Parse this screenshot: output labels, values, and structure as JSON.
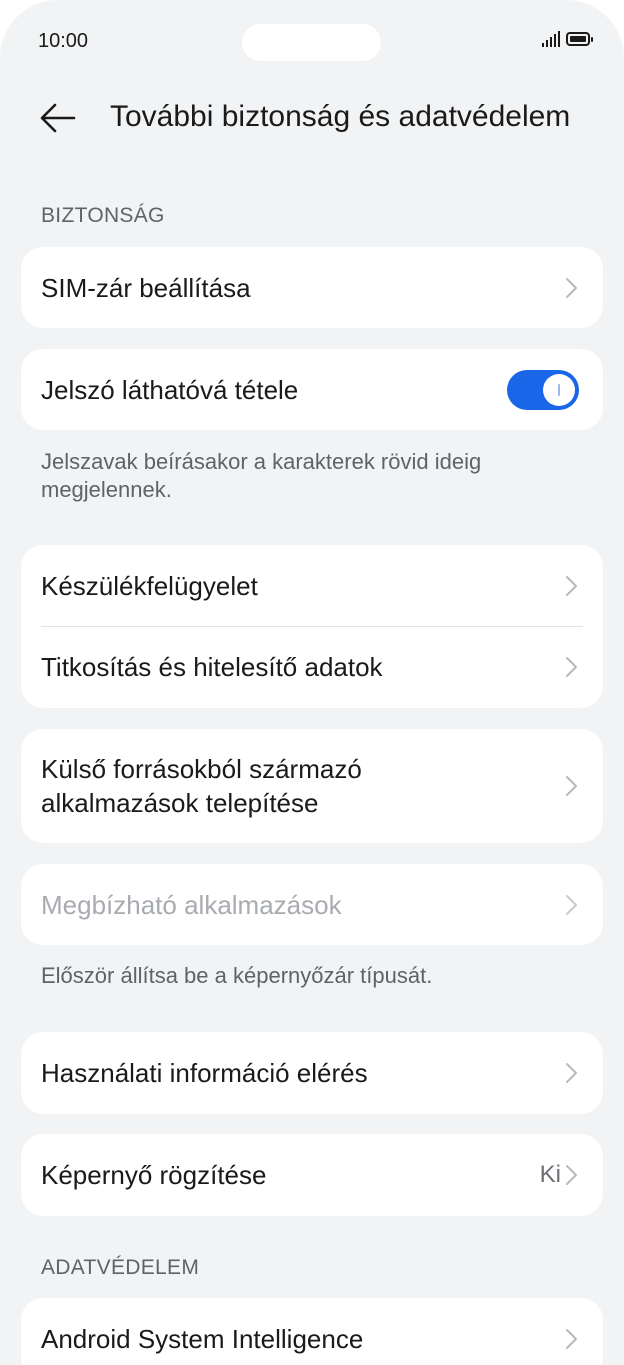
{
  "status_bar": {
    "time": "10:00"
  },
  "header": {
    "title": "További biztonság és adatvédelem"
  },
  "sections": {
    "security_label": "BIZTONSÁG",
    "privacy_label": "ADATVÉDELEM"
  },
  "items": {
    "sim_lock": {
      "label": "SIM-zár beállítása"
    },
    "show_password": {
      "label": "Jelszó láthatóvá tétele",
      "enabled": true
    },
    "show_password_note": "Jelszavak beírásakor a karakterek rövid ideig megjelennek.",
    "device_admin": {
      "label": "Készülékfelügyelet"
    },
    "encryption": {
      "label": "Titkosítás és hitelesítő adatok"
    },
    "external_sources": {
      "label": "Külső forrásokból származó alkalmazások telepítése"
    },
    "trusted_agents": {
      "label": "Megbízható alkalmazások",
      "disabled": true
    },
    "trusted_agents_note": "Először állítsa be a képernyőzár típusát.",
    "usage_access": {
      "label": "Használati információ elérés"
    },
    "screen_pinning": {
      "label": "Képernyő rögzítése",
      "value": "Ki"
    },
    "android_system_intelligence": {
      "label": "Android System Intelligence"
    }
  },
  "colors": {
    "background": "#f1f3f5",
    "card": "#ffffff",
    "accent": "#1967e8",
    "disabled_text": "#a8abb0",
    "secondary_text": "#5f6368"
  },
  "icons": {
    "back": "arrow-left-icon",
    "chevron": "chevron-right-icon",
    "signal": "signal-icon",
    "battery": "battery-icon"
  }
}
